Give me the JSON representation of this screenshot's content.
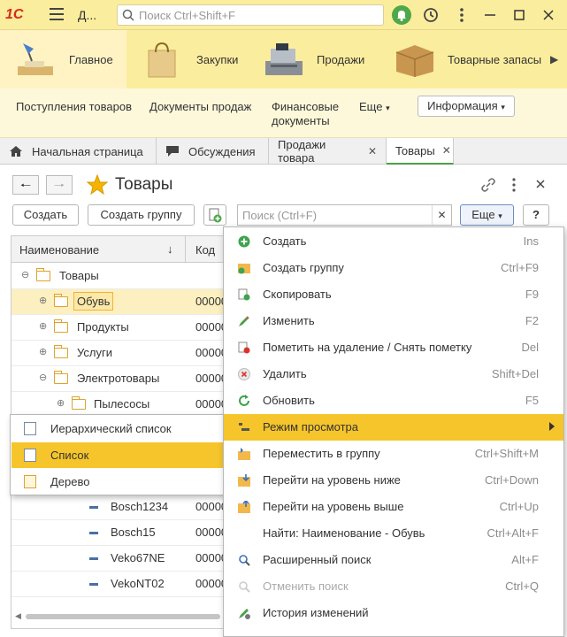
{
  "titlebar": {
    "app_name": "Д...",
    "search_placeholder": "Поиск Ctrl+Shift+F"
  },
  "sections": [
    {
      "label": "Главное",
      "icon": "desk-lamp-icon"
    },
    {
      "label": "Закупки",
      "icon": "shopping-bag-icon"
    },
    {
      "label": "Продажи",
      "icon": "cash-register-icon"
    },
    {
      "label": "Товарные запасы",
      "icon": "box-icon"
    }
  ],
  "subpanel": {
    "items": [
      "Поступления товаров",
      "Документы продаж",
      "Финансовые",
      "документы",
      "Еще"
    ],
    "info": "Информация"
  },
  "tabs": [
    {
      "label": "Начальная страница"
    },
    {
      "label": "Обсуждения"
    },
    {
      "label": "Продажи товара"
    },
    {
      "label": "Товары"
    }
  ],
  "form": {
    "title": "Товары",
    "create": "Создать",
    "create_group": "Создать группу",
    "search_placeholder": "Поиск (Ctrl+F)",
    "more": "Еще",
    "help": "?"
  },
  "grid": {
    "columns": [
      "Наименование",
      "Код"
    ],
    "rows": [
      {
        "name": "Товары",
        "code": ""
      },
      {
        "name": "Обувь",
        "code": "00000"
      },
      {
        "name": "Продукты",
        "code": "00000"
      },
      {
        "name": "Услуги",
        "code": "00000"
      },
      {
        "name": "Электротовары",
        "code": "00000"
      },
      {
        "name": "Пылесосы",
        "code": "00000"
      },
      {
        "name": "Bosch1234",
        "code": "00000"
      },
      {
        "name": "Bosch15",
        "code": "00000"
      },
      {
        "name": "Veko67NE",
        "code": "00000"
      },
      {
        "name": "VekoNT02",
        "code": "00000"
      }
    ]
  },
  "view_modes": [
    {
      "label": "Иерархический список"
    },
    {
      "label": "Список"
    },
    {
      "label": "Дерево"
    }
  ],
  "menu": [
    {
      "label": "Создать",
      "shortcut": "Ins"
    },
    {
      "label": "Создать группу",
      "shortcut": "Ctrl+F9"
    },
    {
      "label": "Скопировать",
      "shortcut": "F9"
    },
    {
      "label": "Изменить",
      "shortcut": "F2"
    },
    {
      "label": "Пометить на удаление / Снять пометку",
      "shortcut": "Del"
    },
    {
      "label": "Удалить",
      "shortcut": "Shift+Del"
    },
    {
      "label": "Обновить",
      "shortcut": "F5"
    },
    {
      "label": "Режим просмотра",
      "shortcut": ""
    },
    {
      "label": "Переместить в группу",
      "shortcut": "Ctrl+Shift+M"
    },
    {
      "label": "Перейти на уровень ниже",
      "shortcut": "Ctrl+Down"
    },
    {
      "label": "Перейти на уровень выше",
      "shortcut": "Ctrl+Up"
    },
    {
      "label": "Найти: Наименование - Обувь",
      "shortcut": "Ctrl+Alt+F"
    },
    {
      "label": "Расширенный поиск",
      "shortcut": "Alt+F"
    },
    {
      "label": "Отменить поиск",
      "shortcut": "Ctrl+Q"
    },
    {
      "label": "История изменений",
      "shortcut": ""
    }
  ],
  "colors": {
    "accent_yellow": "#f5c52b",
    "panel_yellow": "#fbed9e",
    "active_green": "#4a9f47"
  }
}
